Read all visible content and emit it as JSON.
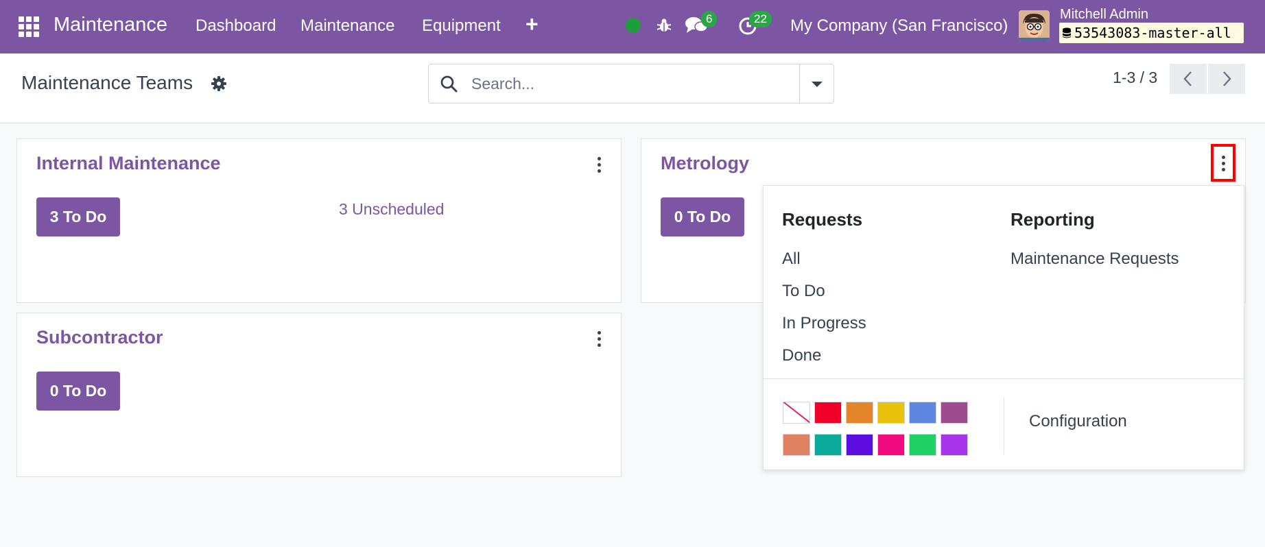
{
  "navbar": {
    "app_name": "Maintenance",
    "menu": [
      "Dashboard",
      "Maintenance",
      "Equipment"
    ],
    "plus": "+",
    "messages_count": "6",
    "activities_count": "22",
    "company": "My Company (San Francisco)",
    "user_name": "Mitchell Admin",
    "database": "53543083-master-all",
    "status_color": "#1e9e3a",
    "accent": "#7c56a2"
  },
  "control_panel": {
    "title": "Maintenance Teams",
    "search_placeholder": "Search...",
    "pager": "1-3 / 3"
  },
  "teams": [
    {
      "name": "Internal Maintenance",
      "todo": "3 To Do",
      "unscheduled": "3 Unscheduled"
    },
    {
      "name": "Metrology",
      "todo": "0 To Do"
    },
    {
      "name": "Subcontractor",
      "todo": "0 To Do"
    }
  ],
  "dropdown": {
    "requests_heading": "Requests",
    "requests_items": [
      "All",
      "To Do",
      "In Progress",
      "Done"
    ],
    "reporting_heading": "Reporting",
    "reporting_items": [
      "Maintenance Requests"
    ],
    "configuration": "Configuration",
    "colors": [
      "none",
      "#f2002a",
      "#e38528",
      "#e9c30b",
      "#5d86e0",
      "#9e4c8e",
      "#e08262",
      "#0ba99a",
      "#5c0de0",
      "#f20a80",
      "#1fd065",
      "#a835eb"
    ]
  }
}
